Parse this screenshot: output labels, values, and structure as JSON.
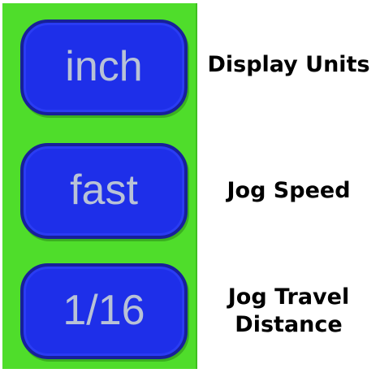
{
  "panel": {
    "background_color": "#4fdd2b",
    "button_color": "#1e2fe9",
    "button_text_color": "#b8c2d6"
  },
  "controls": [
    {
      "key": "display_units",
      "value": "inch",
      "label": "Display Units"
    },
    {
      "key": "jog_speed",
      "value": "fast",
      "label": "Jog Speed"
    },
    {
      "key": "jog_travel_distance",
      "value": "1/16",
      "label_lines": [
        "Jog Travel",
        "Distance"
      ]
    }
  ]
}
